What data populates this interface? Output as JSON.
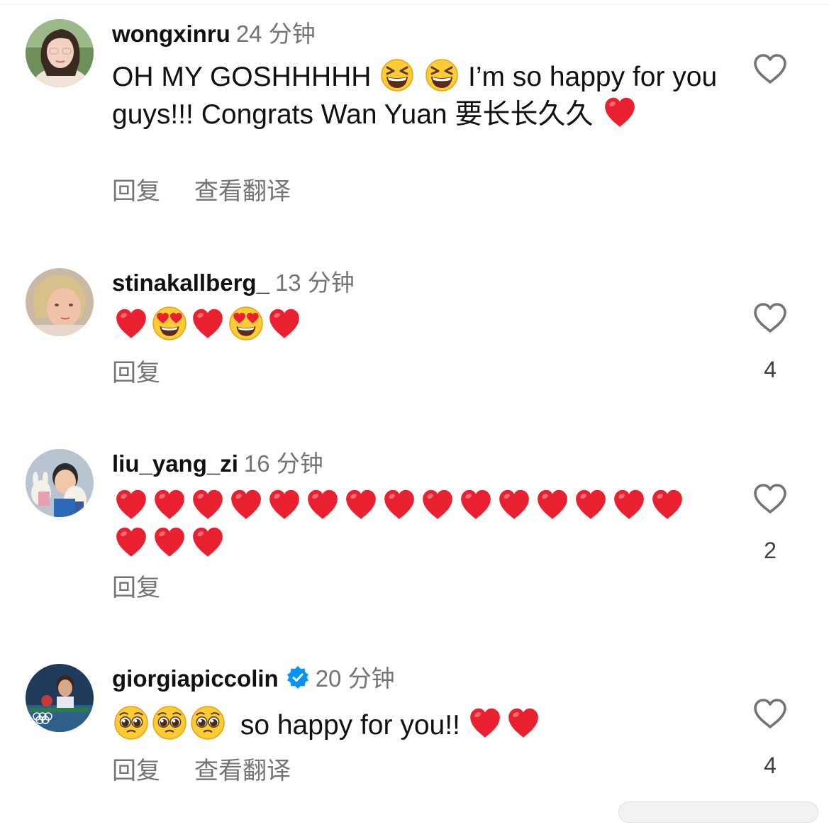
{
  "comments": [
    {
      "username": "wongxinru",
      "time": "24 分钟",
      "verified": false,
      "text_parts": [
        "OH MY GOSHHHHH",
        "I’m so happy for you guys!!! Congrats Wan Yuan 要长长久久"
      ],
      "emojis": [
        "grinning-squinting-face",
        "grinning-squinting-face",
        "red-heart"
      ],
      "reply_label": "回复",
      "translate_label": "查看翻译",
      "likes": ""
    },
    {
      "username": "stinakallberg_",
      "time": "13 分钟",
      "verified": false,
      "emojis": [
        "red-heart",
        "heart-eyes-face",
        "red-heart",
        "heart-eyes-face",
        "red-heart"
      ],
      "reply_label": "回复",
      "likes": "4"
    },
    {
      "username": "liu_yang_zi",
      "time": "16 分钟",
      "verified": false,
      "emojis": [
        "red-heart x18"
      ],
      "reply_label": "回复",
      "likes": "2"
    },
    {
      "username": "giorgiapiccolin",
      "time": "20 分钟",
      "verified": true,
      "text_parts": [
        "so happy for you!!"
      ],
      "emojis": [
        "pleading-face",
        "pleading-face",
        "pleading-face",
        "red-heart",
        "red-heart"
      ],
      "reply_label": "回复",
      "translate_label": "查看翻译",
      "likes": "4"
    }
  ],
  "colors": {
    "username": "#111111",
    "secondary_text": "#737373",
    "verified_badge": "#0095f6",
    "heart_emoji": "#e8202f"
  }
}
